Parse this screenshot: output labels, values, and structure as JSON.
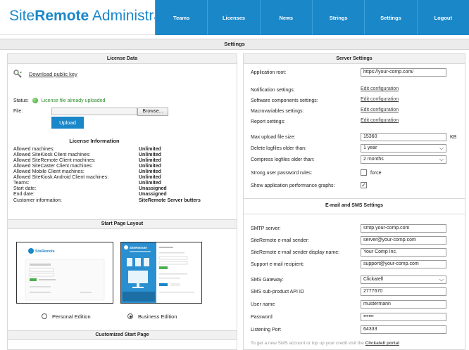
{
  "brand": {
    "prefix": "Site",
    "bold": "Remote",
    "suffix": " Administration"
  },
  "nav": [
    "Teams",
    "Licenses",
    "News",
    "Strings",
    "Settings",
    "Logout"
  ],
  "page_title": "Settings",
  "license": {
    "header": "License Data",
    "download": "Download public key",
    "status_label": "Status:",
    "status_text": "License file already uploaded",
    "file_label": "File:",
    "browse": "Browse...",
    "upload": "Upload",
    "info_title": "License Information",
    "rows": [
      {
        "label": "Allowed machines:",
        "value": "Unlimited"
      },
      {
        "label": "Allowed SiteKiosk Client machines:",
        "value": "Unlimited"
      },
      {
        "label": "Allowed SiteRemote Client machines:",
        "value": "Unlimited"
      },
      {
        "label": "Allowed SiteCaster Client machines:",
        "value": "Unlimited"
      },
      {
        "label": "Allowed Mobile Client machines:",
        "value": "Unlimited"
      },
      {
        "label": "Allowed SiteKiosk Android Client machines:",
        "value": "Unlimited"
      },
      {
        "label": "Teams:",
        "value": "Unlimited"
      },
      {
        "label": "Start date:",
        "value": "Unassigned"
      },
      {
        "label": "End date:",
        "value": "Unassigned"
      },
      {
        "label": "Customer information:",
        "value": "SiteRemote Server butters"
      }
    ]
  },
  "start_page": {
    "header": "Start Page Layout",
    "personal": "Personal Edition",
    "business": "Business Edition",
    "selected": "business",
    "thumb_personal_title": "SiteRemote",
    "thumb_business_title": "SiteRemote"
  },
  "customized_header": "Customized Start Page",
  "server": {
    "header": "Server Settings",
    "app_root_label": "Application root:",
    "app_root_value": "https://your-comp.com/",
    "notification_label": "Notification settings:",
    "software_label": "Software components settings:",
    "macro_label": "Macrovariables settings:",
    "report_label": "Report settings:",
    "edit_link": "Edit configuration",
    "max_upload_label": "Max upload file size:",
    "max_upload_value": "15360",
    "max_upload_unit": "KB",
    "delete_logs_label": "Delete logfiles older than:",
    "delete_logs_value": "1 year",
    "compress_logs_label": "Compress logfiles older than:",
    "compress_logs_value": "2 months",
    "strong_pw_label": "Strong user password rules:",
    "strong_pw_force": "force",
    "strong_pw_checked": false,
    "perf_graphs_label": "Show application performance graphs:",
    "perf_graphs_checked": true
  },
  "email": {
    "header": "E-mail and SMS Settings",
    "smtp_label": "SMTP server:",
    "smtp_value": "smtp.your-comp.com",
    "sender_label": "SiteRemote e-mail sender:",
    "sender_value": "server@your-comp.com",
    "display_label": "SiteRemote e-mail sender display name:",
    "display_value": "Your Comp Inc.",
    "support_label": "Support e-mail recipient:",
    "support_value": "support@your-comp.com",
    "gateway_label": "SMS Gateway:",
    "gateway_value": "Clickatell",
    "api_label": "SMS sub-product API ID",
    "api_value": "2777670",
    "user_label": "User name",
    "user_value": "mustermann",
    "password_label": "Password",
    "password_value": "••••••",
    "port_label": "Listening Port",
    "port_value": "64333",
    "footer_text": "To get a new SMS account or top up your credit visit the",
    "footer_link": "Clickatell portal"
  }
}
